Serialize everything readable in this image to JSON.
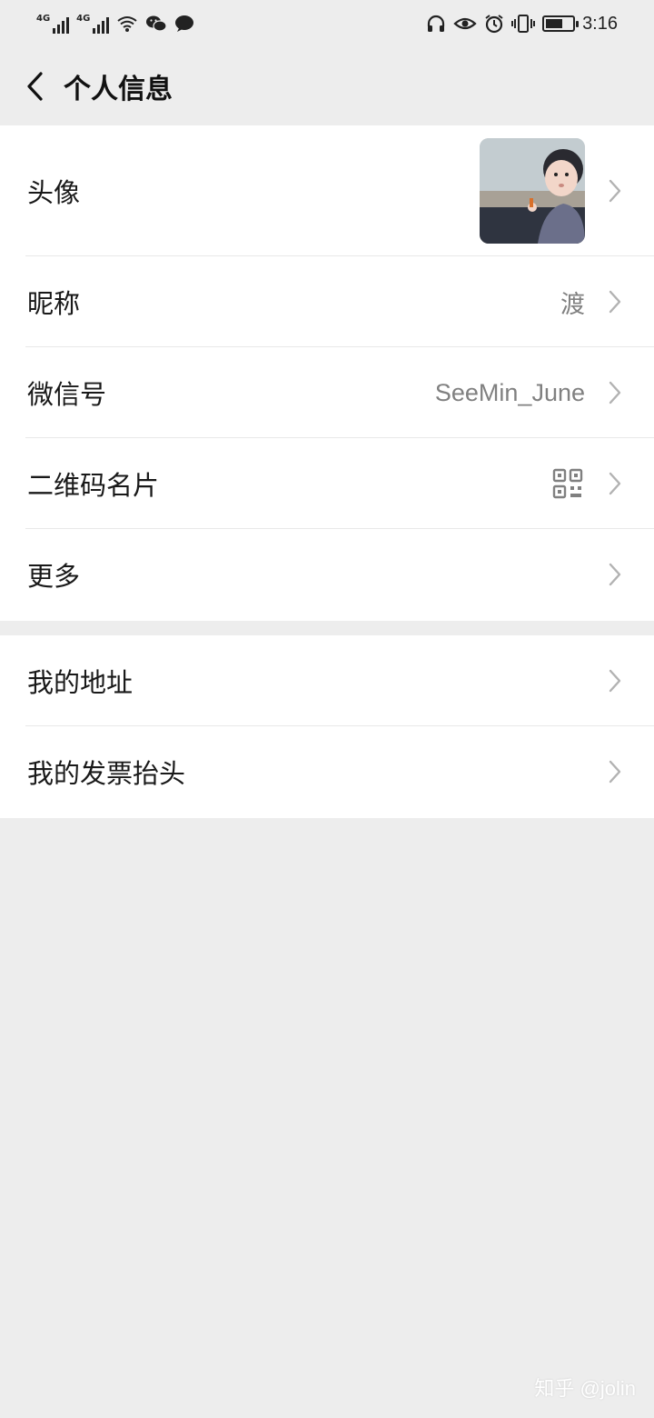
{
  "status_bar": {
    "net1": "4G",
    "net2": "4G",
    "time": "3:16",
    "battery_level": 0.65,
    "icons": [
      "signal-icon",
      "signal-icon",
      "wifi-icon",
      "wechat-icon",
      "message-icon",
      "headphones-icon",
      "eye-icon",
      "alarm-icon",
      "vibrate-icon",
      "battery-icon"
    ]
  },
  "nav": {
    "title": "个人信息",
    "back_icon": "chevron-left-icon"
  },
  "groups": {
    "main": {
      "avatar_label": "头像",
      "nickname_label": "昵称",
      "nickname_value": "渡",
      "wechat_id_label": "微信号",
      "wechat_id_value": "SeeMin_June",
      "qr_label": "二维码名片",
      "more_label": "更多"
    },
    "secondary": {
      "address_label": "我的地址",
      "invoice_label": "我的发票抬头"
    }
  },
  "watermark": "知乎 @jolin",
  "colors": {
    "background": "#ededed",
    "row_bg": "#ffffff",
    "label_text": "#191919",
    "value_text": "#808080",
    "chevron": "#b2b2b2"
  }
}
